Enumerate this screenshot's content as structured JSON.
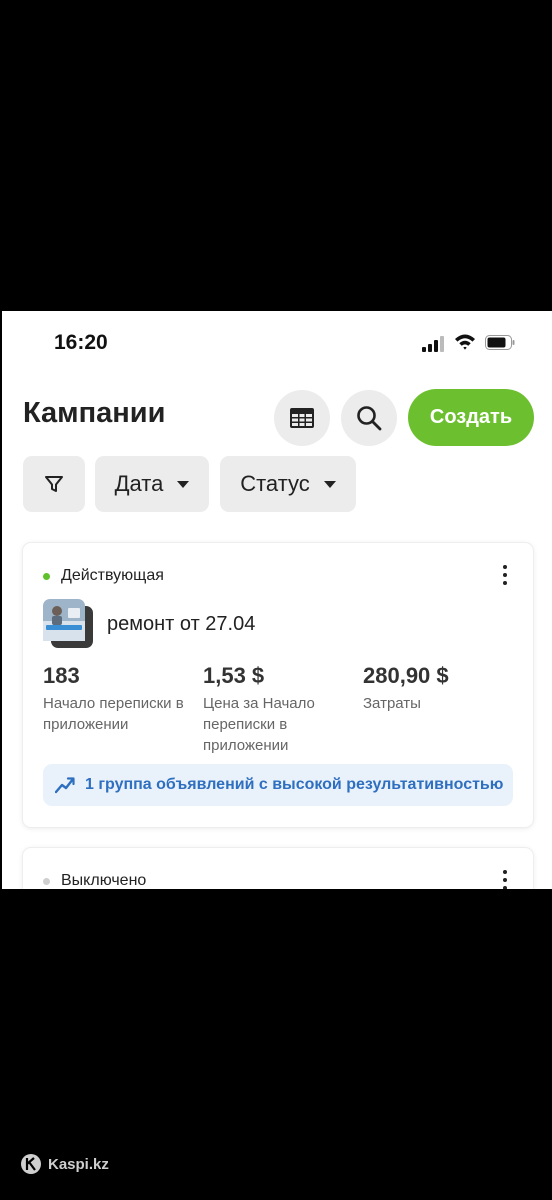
{
  "status_bar": {
    "time": "16:20"
  },
  "header": {
    "title": "Кампании",
    "create_label": "Создать"
  },
  "filters": {
    "date_label": "Дата",
    "status_label": "Статус"
  },
  "campaigns": [
    {
      "status": "Действующая",
      "status_color": "#5fc22c",
      "name": "ремонт от 27.04",
      "metrics": [
        {
          "value": "183",
          "label": "Начало переписки в приложении"
        },
        {
          "value": "1,53 $",
          "label": "Цена за Начало переписки в приложении"
        },
        {
          "value": "280,90 $",
          "label": "Затраты"
        }
      ],
      "banner": "1 группа объявлений с высокой результативностью"
    },
    {
      "status": "Выключено",
      "status_color": "#cfcfcf"
    }
  ],
  "watermark": "Kaspi.kz",
  "colors": {
    "accent": "#6cc02f",
    "banner_bg": "#e9f2fb",
    "banner_text": "#2f6fc0"
  }
}
